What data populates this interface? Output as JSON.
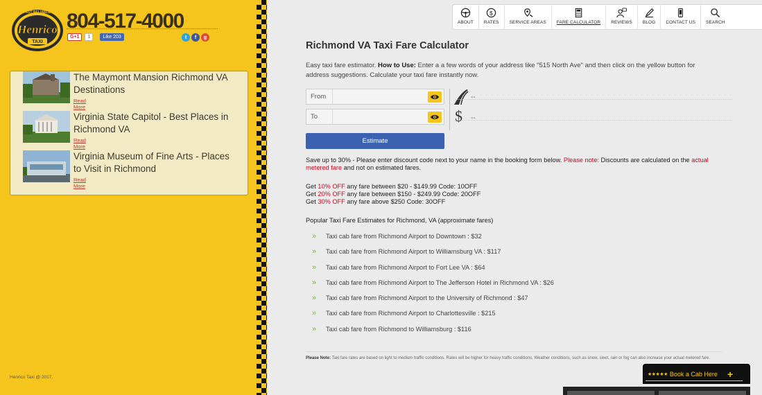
{
  "header": {
    "phone": "804-517-4000",
    "logo_text": "Henrico",
    "logo_subtext": "TAXI",
    "logo_arc": "24/7 FAST RELIABLE TAXI",
    "gplus_label": "G+1",
    "gplus_count": "1",
    "fb_like": "Like 203"
  },
  "nav": [
    {
      "label": "ABOUT",
      "icon": "steering-wheel-icon"
    },
    {
      "label": "RATES",
      "icon": "dollar-icon"
    },
    {
      "label": "SERVICE AREAS",
      "icon": "map-pin-icon"
    },
    {
      "label": "FARE CALCULATOR",
      "icon": "calculator-icon",
      "active": true
    },
    {
      "label": "REVIEWS",
      "icon": "reviews-icon"
    },
    {
      "label": "BLOG",
      "icon": "pencil-icon"
    },
    {
      "label": "CONTACT US",
      "icon": "phone-icon"
    },
    {
      "label": "SEARCH",
      "icon": "search-icon"
    }
  ],
  "destinations": [
    {
      "title": "The Maymont Mansion Richmond VA Destinations",
      "read_more": "Read More"
    },
    {
      "title": "Virginia State Capitol - Best Places in Richmond VA",
      "read_more": "Read More"
    },
    {
      "title": "Virginia Museum of Fine Arts - Places to Visit in Richmond",
      "read_more": "Read More"
    }
  ],
  "copyright": "Henrico Taxi @ 2017.",
  "main": {
    "title": "Richmond VA Taxi Fare Calculator",
    "intro_a": "Easy taxi fare estimator. ",
    "intro_bold": "How to Use:",
    "intro_b": " Enter a a few words of your address like \"515 North Ave\" and then click on the yellow button for address suggestions. Calculate your taxi fare instantly now."
  },
  "calculator": {
    "from_label": "From",
    "to_label": "To",
    "from_value": "",
    "to_value": "",
    "distance_value": "--",
    "price_value": "--",
    "estimate_label": "Estimate"
  },
  "save": {
    "a": "Save up to 30% - Please enter discount code next to your name in the booking form below. ",
    "note_red": "Please note:",
    "b": " Discounts are calculated on the ",
    "metered_red": "actual metered fare",
    "c": " and not on estimated fares."
  },
  "discounts": [
    {
      "prefix": "Get ",
      "pct": "10% OFF",
      "rest": " any fare between $20 - $149.99 Code: 10OFF"
    },
    {
      "prefix": "Get ",
      "pct": "20% OFF",
      "rest": " any fare between $150 - $249.99 Code: 20OFF"
    },
    {
      "prefix": "Get ",
      "pct": "30% OFF",
      "rest": " any fare above $250 Code: 30OFF"
    }
  ],
  "popular_title": "Popular Taxi Fare Estimates for Richmond, VA (approximate fares)",
  "fares": [
    "Taxi cab fare from Richmond Airport to Downtown : $32",
    "Taxi cab fare from Richmond Airport to Williamsburg VA : $117",
    "Taxi cab fare from Richmond Airport to Fort Lee VA : $64",
    "Taxi cab fare from Richmond Airport to The Jefferson Hotel in Richmond VA : $26",
    "Taxi cab fare from Richmond Airport to the University of Richmond : $47",
    "Taxi cab fare from Richmond Airport to Charlottesville : $215",
    "Taxi cab fare from Richmond to Williamsburg : $116"
  ],
  "note": {
    "label": "Please Note:",
    "text": " Taxi fare rates are based on light to medium traffic conditions. Rates will be higher for heavy traffic conditions. Weather conditions, such as snow, sleet, rain or fog can also increase your actual metered fare."
  },
  "book": {
    "stars": "★★★★★",
    "label": "Book a Cab Here",
    "plus": "+"
  },
  "colors": {
    "brand_yellow": "#f6c51d",
    "button_blue": "#3b62b0",
    "accent_red": "#d0021b",
    "arrow_green": "#7cb940"
  }
}
